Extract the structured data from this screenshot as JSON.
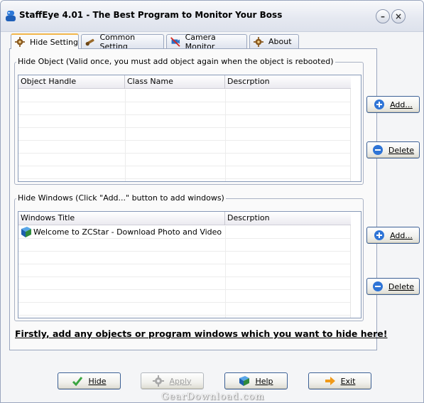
{
  "window": {
    "title": "StaffEye 4.01 - The Best Program to Monitor Your Boss",
    "minimize_symbol": "–",
    "close_symbol": "×"
  },
  "tabs": [
    {
      "label": "Hide Setting",
      "icon": "gear-icon",
      "active": true
    },
    {
      "label": "Common Setting",
      "icon": "tools-icon",
      "active": false
    },
    {
      "label": "Camera Monitor",
      "icon": "camera-icon",
      "active": false
    },
    {
      "label": "About",
      "icon": "gear-icon",
      "active": false
    }
  ],
  "hide_object": {
    "group_title": "Hide Object (Valid once, you must add object again when the object is rebooted)",
    "columns": [
      "Object Handle",
      "Class Name",
      "Descrption"
    ],
    "rows": [],
    "add_label": "Add...",
    "delete_label": "Delete"
  },
  "hide_windows": {
    "group_title": "Hide Windows (Click \"Add...\" button to add windows)",
    "columns": [
      "Windows Title",
      "Descrption"
    ],
    "rows": [
      {
        "title": "Welcome to ZCStar - Download Photo and Video Soft...",
        "description": "",
        "icon": "book-icon"
      }
    ],
    "add_label": "Add...",
    "delete_label": "Delete"
  },
  "hint_text": "Firstly, add any objects or program windows which you want to hide here!",
  "footer_buttons": {
    "hide_label": "Hide",
    "apply_label": "Apply",
    "help_label": "Help",
    "exit_label": "Exit"
  },
  "watermark": "GearDownload.com",
  "colors": {
    "accent_tab": "#f3b64a",
    "button_border": "#3c6095",
    "panel_border": "#9aa6be"
  }
}
